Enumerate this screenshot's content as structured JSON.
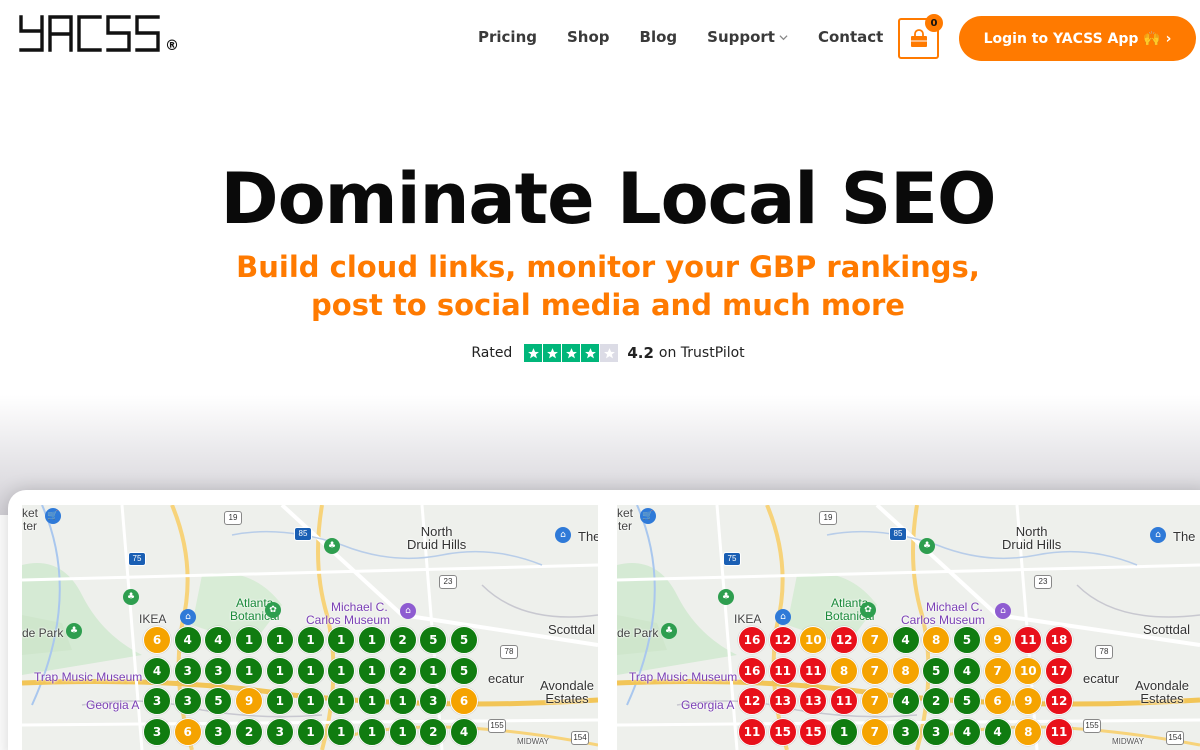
{
  "header": {
    "logo_text": "YACSS",
    "logo_reg": "®",
    "nav": [
      {
        "label": "Pricing"
      },
      {
        "label": "Shop"
      },
      {
        "label": "Blog"
      },
      {
        "label": "Support",
        "has_dropdown": true
      },
      {
        "label": "Contact"
      }
    ],
    "cart_count": "0",
    "login_label": "Login to YACSS App 🙌 ›"
  },
  "hero": {
    "title": "Dominate Local SEO",
    "subtitle_line1": "Build cloud links, monitor your GBP rankings,",
    "subtitle_line2": "post to social media and much more",
    "rating_prefix": "Rated",
    "rating_value": "4.2",
    "rating_suffix": "on TrustPilot",
    "stars_filled": 4,
    "stars_total": 5
  },
  "colors": {
    "accent": "#ff7a00",
    "trustpilot_green": "#00b67a",
    "rank_green": "#107c10",
    "rank_orange": "#f5a300",
    "rank_red": "#e8101a"
  },
  "maps": [
    {
      "labels": {
        "market": "ket\nter",
        "north_druid": "North\nDruid Hills",
        "the": "The",
        "atlanta_botanical": "Atlanta\nBotanical",
        "michael_c": "Michael C.",
        "carlos": "Carlos Museum",
        "ikea": "IKEA",
        "de_park": "de Park",
        "scottdal": "Scottdal",
        "trap": "Trap Music Museum",
        "decatur": "ecatur",
        "avondale": "Avondale\nEstates",
        "georgia": "Georgia A",
        "midway": "MIDWAY\nWOODS",
        "r19": "19",
        "r75": "75",
        "r85": "85",
        "r23": "23",
        "r78": "78",
        "r155": "155",
        "r154": "154"
      },
      "grid": [
        [
          "6",
          "4",
          "4",
          "1",
          "1",
          "1",
          "1",
          "1",
          "2",
          "5",
          "5"
        ],
        [
          "4",
          "3",
          "3",
          "1",
          "1",
          "1",
          "1",
          "1",
          "2",
          "1",
          "5"
        ],
        [
          "3",
          "3",
          "5",
          "9",
          "1",
          "1",
          "1",
          "1",
          "1",
          "3",
          "6"
        ],
        [
          "3",
          "6",
          "3",
          "2",
          "3",
          "1",
          "1",
          "1",
          "1",
          "2",
          "4"
        ]
      ],
      "grid_colors": [
        [
          "o",
          "g",
          "g",
          "g",
          "g",
          "g",
          "g",
          "g",
          "g",
          "g",
          "g"
        ],
        [
          "g",
          "g",
          "g",
          "g",
          "g",
          "g",
          "g",
          "g",
          "g",
          "g",
          "g"
        ],
        [
          "g",
          "g",
          "g",
          "o",
          "g",
          "g",
          "g",
          "g",
          "g",
          "g",
          "o"
        ],
        [
          "g",
          "o",
          "g",
          "g",
          "g",
          "g",
          "g",
          "g",
          "g",
          "g",
          "g"
        ]
      ]
    },
    {
      "labels": {
        "market": "ket\nter",
        "north_druid": "North\nDruid Hills",
        "the": "The",
        "atlanta_botanical": "Atlanta\nBotanical",
        "michael_c": "Michael C.",
        "carlos": "Carlos Museum",
        "ikea": "IKEA",
        "de_park": "de Park",
        "scottdal": "Scottdal",
        "trap": "Trap Music Museum",
        "decatur": "ecatur",
        "avondale": "Avondale\nEstates",
        "georgia": "Georgia A",
        "midway": "MIDWAY\nWOODS",
        "r19": "19",
        "r75": "75",
        "r85": "85",
        "r23": "23",
        "r78": "78",
        "r155": "155",
        "r154": "154"
      },
      "grid": [
        [
          "16",
          "12",
          "10",
          "12",
          "7",
          "4",
          "8",
          "5",
          "9",
          "11",
          "18"
        ],
        [
          "16",
          "11",
          "11",
          "8",
          "7",
          "8",
          "5",
          "4",
          "7",
          "10",
          "17"
        ],
        [
          "12",
          "13",
          "13",
          "11",
          "7",
          "4",
          "2",
          "5",
          "6",
          "9",
          "12"
        ],
        [
          "11",
          "15",
          "15",
          "1",
          "7",
          "3",
          "3",
          "4",
          "4",
          "8",
          "11"
        ]
      ],
      "grid_colors": [
        [
          "r",
          "r",
          "o",
          "r",
          "o",
          "g",
          "o",
          "g",
          "o",
          "r",
          "r"
        ],
        [
          "r",
          "r",
          "r",
          "o",
          "o",
          "o",
          "g",
          "g",
          "o",
          "o",
          "r"
        ],
        [
          "r",
          "r",
          "r",
          "r",
          "o",
          "g",
          "g",
          "g",
          "o",
          "o",
          "r"
        ],
        [
          "r",
          "r",
          "r",
          "g",
          "o",
          "g",
          "g",
          "g",
          "g",
          "o",
          "r"
        ]
      ]
    }
  ]
}
